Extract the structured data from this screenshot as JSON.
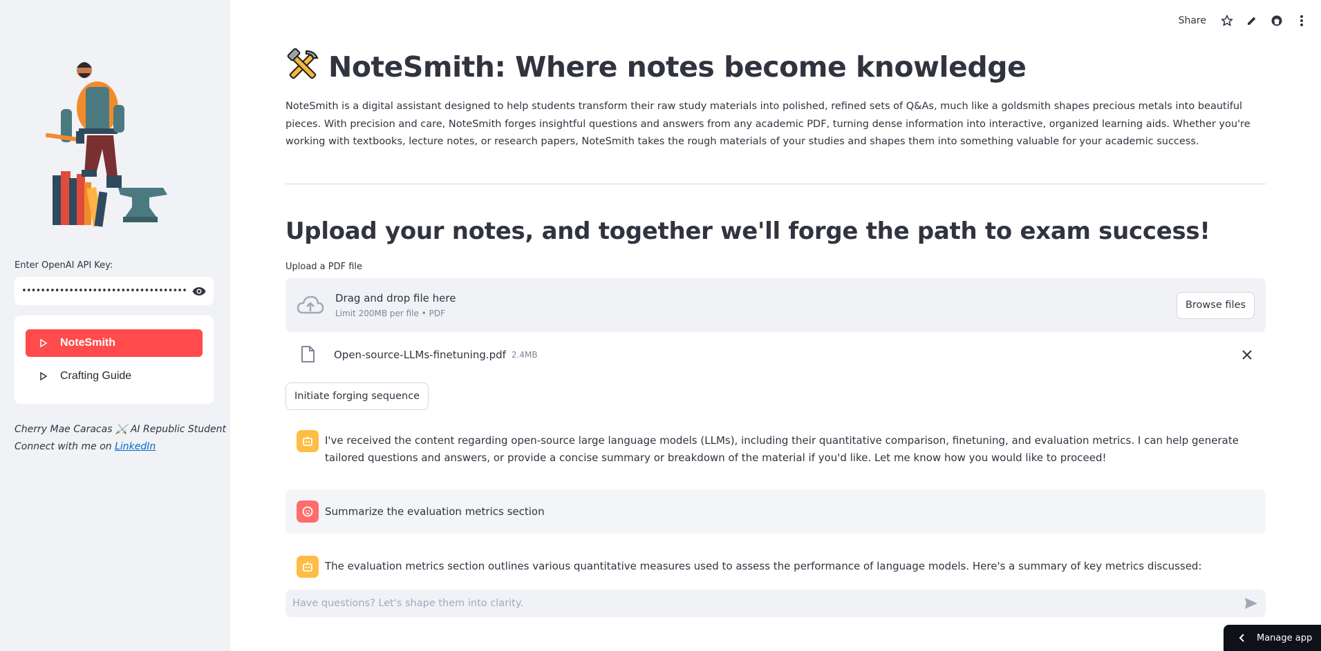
{
  "sidebar": {
    "api_label": "Enter OpenAI API Key:",
    "api_value": "••••••••••••••••••••••••••••••••••••••••••••••••••",
    "nav": [
      {
        "label": "NoteSmith",
        "active": true
      },
      {
        "label": "Crafting Guide",
        "active": false
      }
    ],
    "credit_line1": "Cherry Mae Caracas",
    "credit_line1_suffix": "AI Republic Student",
    "credit_connect": "Connect with me on",
    "credit_link": "LinkedIn"
  },
  "toolbar": {
    "share_label": "Share",
    "icons": [
      "star-icon",
      "pencil-icon",
      "github-icon",
      "more-vertical-icon"
    ]
  },
  "main": {
    "title": "NoteSmith: Where notes become knowledge",
    "description": "NoteSmith is a digital assistant designed to help students transform their raw study materials into polished, refined sets of Q&As, much like a goldsmith shapes precious metals into beautiful pieces. With precision and care, NoteSmith forges insightful questions and answers from any academic PDF, turning dense information into interactive, organized learning aids. Whether you're working with textbooks, lecture notes, or research papers, NoteSmith takes the rough materials of your studies and shapes them into something valuable for your academic success.",
    "subheading": "Upload your notes, and together we'll forge the path to exam success!",
    "upload_label": "Upload a PDF file",
    "dropzone_title": "Drag and drop file here",
    "dropzone_limit": "Limit 200MB per file • PDF",
    "browse_label": "Browse files",
    "file_name": "Open-source-LLMs-finetuning.pdf",
    "file_size": "2.4MB",
    "forge_button": "Initiate forging sequence"
  },
  "chat": {
    "messages": [
      {
        "role": "assistant",
        "text": "I've received the content regarding open-source large language models (LLMs), including their quantitative comparison, finetuning, and evaluation metrics. I can help generate tailored questions and answers, or provide a concise summary or breakdown of the material if you'd like. Let me know how you would like to proceed!"
      },
      {
        "role": "user",
        "text": "Summarize the evaluation metrics section"
      },
      {
        "role": "assistant",
        "text": "The evaluation metrics section outlines various quantitative measures used to assess the performance of language models. Here's a summary of key metrics discussed:"
      }
    ],
    "input_placeholder": "Have questions? Let's shape them into clarity."
  },
  "footer": {
    "manage_app": "Manage app"
  },
  "colors": {
    "primary": "#ff4b4b",
    "sidebar_bg": "#f0f2f6",
    "bot_avatar": "#ffbd45",
    "user_avatar": "#ff6c6c",
    "link": "#0068c9"
  }
}
